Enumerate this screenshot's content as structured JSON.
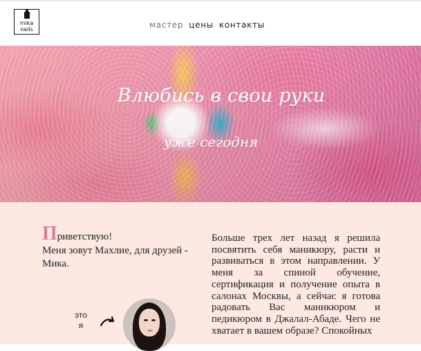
{
  "brand": {
    "logo_line1": "mika",
    "logo_line2": "nails"
  },
  "nav": {
    "items": [
      {
        "label": "мастер"
      },
      {
        "label": "цены"
      },
      {
        "label": "контакты"
      }
    ]
  },
  "hero": {
    "title": "Влюбись в свои руки",
    "subtitle": "уже сегодня"
  },
  "intro": {
    "greeting_dropcap": "П",
    "greeting_rest": "риветствую!",
    "name_line": "Меня зовут Махлие, для друзей - Мика."
  },
  "about": {
    "text": "Больше трех лет назад я решила посвятить себя маникюру, расти и развиваться в этом направлении. У меня за спиной обучение, сертификация и получение опыта в салонах Москвы, а сейчас я готова радовать Вас маникюром и педикюром в Джалал-Абаде. Чего не хватает в вашем образе? Спокойных"
  },
  "eto": {
    "line1": "это",
    "line2": "я"
  },
  "colors": {
    "accent_pink": "#d77f96",
    "content_bg": "#fde9e1"
  }
}
